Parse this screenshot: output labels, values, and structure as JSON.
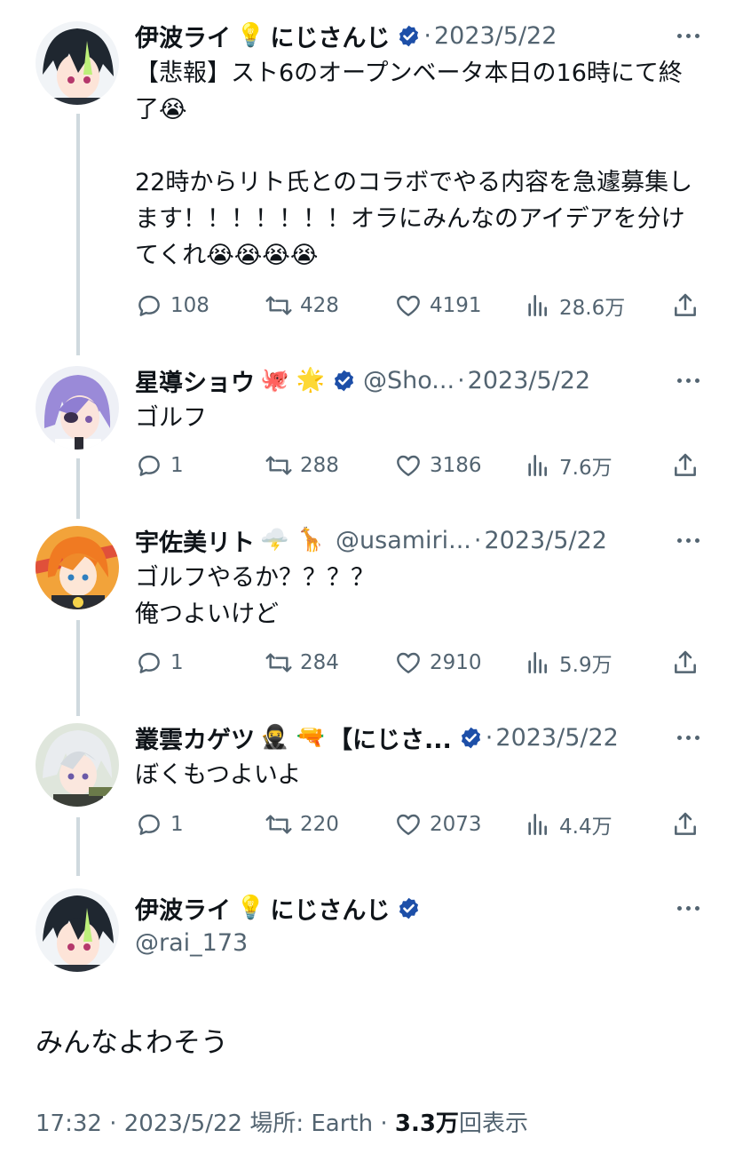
{
  "tweets": [
    {
      "name": "伊波ライ",
      "emojis": "💡",
      "suffix": "にじさんじ",
      "handle": "",
      "date": "2023/5/22",
      "text": "【悲報】スト6のオープンベータ本日の16時にて終了😭\n\n22時からリト氏とのコラボでやる内容を急遽募集します！！！！！！！オラにみんなのアイデアを分けてくれ😭😭😭😭",
      "replies": "108",
      "retweets": "428",
      "likes": "4191",
      "views": "28.6万"
    },
    {
      "name": "星導ショウ",
      "emojis": "🐙 🌟",
      "suffix": "",
      "handle": "@Sho...",
      "date": "2023/5/22",
      "text": "ゴルフ",
      "replies": "1",
      "retweets": "288",
      "likes": "3186",
      "views": "7.6万"
    },
    {
      "name": "宇佐美リト",
      "emojis": "🌩️ 🦒",
      "suffix": "",
      "handle": "@usamiri...",
      "date": "2023/5/22",
      "text": "ゴルフやるか？？？？\n俺つよいけど",
      "replies": "1",
      "retweets": "284",
      "likes": "2910",
      "views": "5.9万"
    },
    {
      "name": "叢雲カゲツ",
      "emojis": "🥷 🔫",
      "suffix": "【にじさ...",
      "handle": "",
      "date": "2023/5/22",
      "text": "ぼくもつよいよ",
      "replies": "1",
      "retweets": "220",
      "likes": "2073",
      "views": "4.4万"
    }
  ],
  "main": {
    "name": "伊波ライ",
    "emojis": "💡",
    "suffix": "にじさんじ",
    "handle": "@rai_173",
    "text": "みんなよわそう",
    "time": "17:32",
    "date": "2023/5/22",
    "location": "場所: Earth",
    "views_count": "3.3万",
    "views_label": "回表示"
  },
  "icons": [
    "reply-icon",
    "retweet-icon",
    "like-icon",
    "views-icon",
    "share-icon",
    "verified-badge-icon",
    "more-icon"
  ],
  "colors": {
    "text": "#0f1419",
    "secondary": "#536471",
    "verified": "#1d4fa8",
    "thread": "#cfd9de"
  }
}
